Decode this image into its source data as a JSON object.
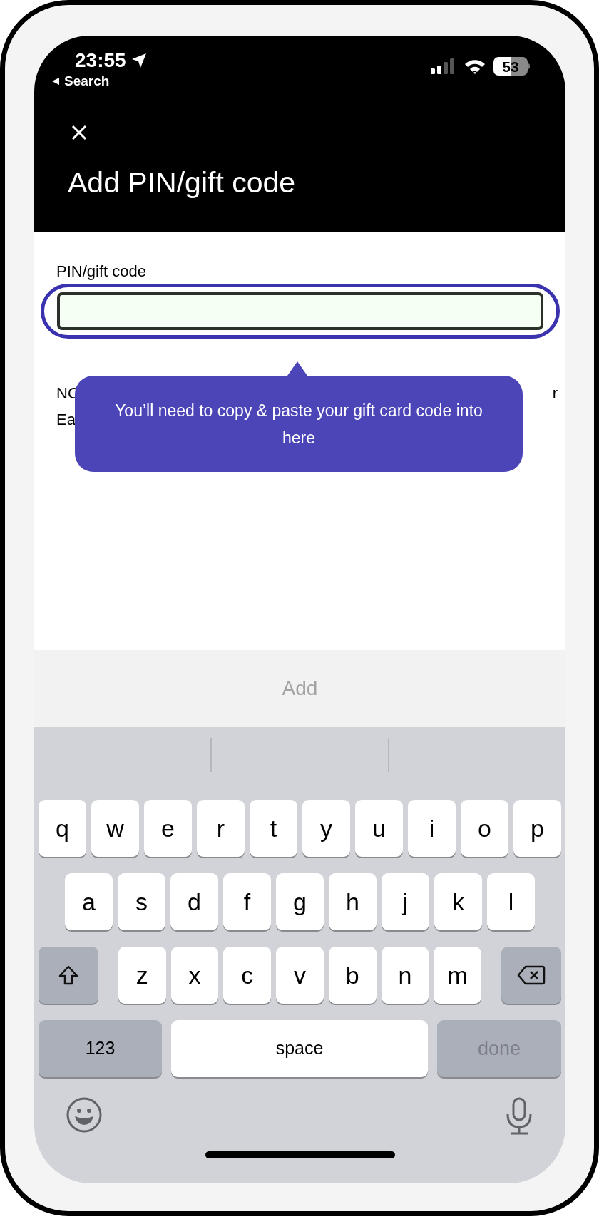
{
  "status_bar": {
    "time": "23:55",
    "back_label": "Search",
    "battery": "53"
  },
  "header": {
    "title": "Add PIN/gift code"
  },
  "field": {
    "label": "PIN/gift code",
    "focused": true
  },
  "note": {
    "line_1_start": "NO",
    "line_1_end": "r",
    "line_2_start": "Ea"
  },
  "tooltip": {
    "text": "You’ll need to copy & paste your gift card code into here"
  },
  "add_button": {
    "label": "Add",
    "disabled": true
  },
  "keyboard": {
    "rows": [
      [
        "q",
        "w",
        "e",
        "r",
        "t",
        "y",
        "u",
        "i",
        "o",
        "p"
      ],
      [
        "a",
        "s",
        "d",
        "f",
        "g",
        "h",
        "j",
        "k",
        "l"
      ],
      [
        "z",
        "x",
        "c",
        "v",
        "b",
        "n",
        "m"
      ]
    ],
    "numbers_key": "123",
    "space_key": "space",
    "done_key": {
      "label": "done",
      "disabled": true
    }
  }
}
